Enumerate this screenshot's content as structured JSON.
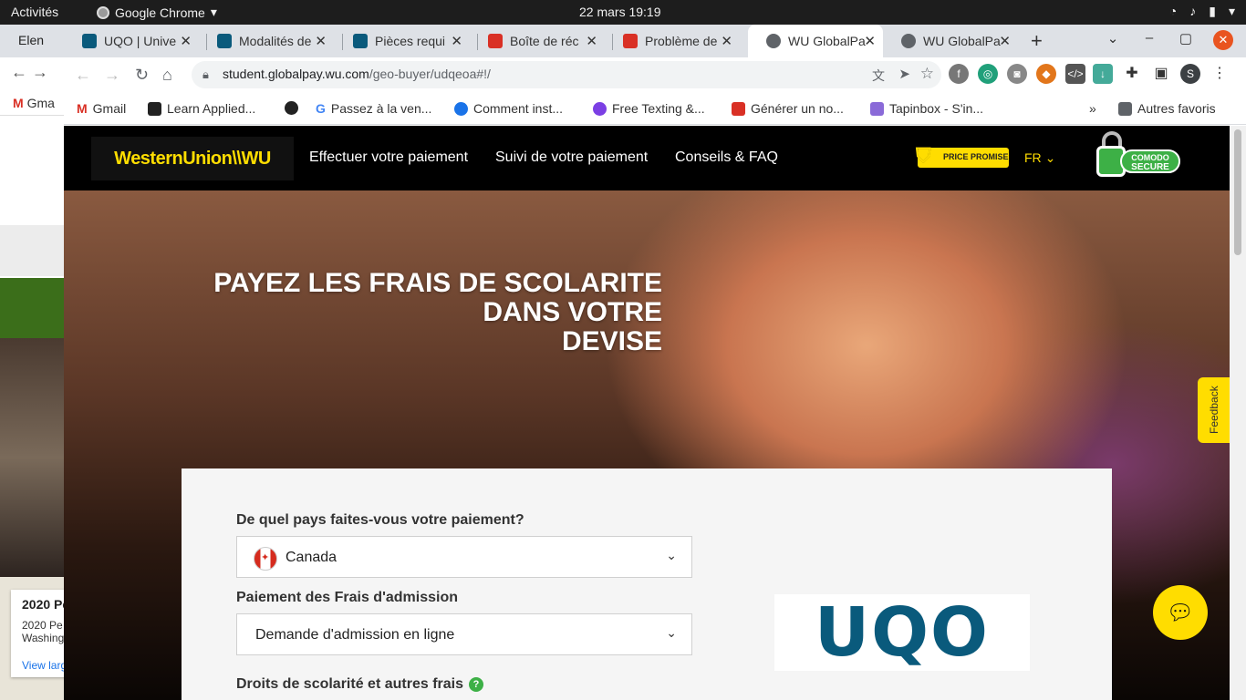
{
  "topbar": {
    "activities": "Activités",
    "app_name": "Google Chrome",
    "clock": "22 mars  19:19"
  },
  "bg_window": {
    "tab_label": "Elen",
    "bookmark": "Gma",
    "map_card_title": "2020 Pe",
    "map_card_line1": "2020 Pe",
    "map_card_line2": "Washing",
    "map_card_link": "View larg"
  },
  "tabs": [
    {
      "label": "UQO | Unive",
      "color": "#0a5a7c"
    },
    {
      "label": "Modalités de",
      "color": "#0a5a7c"
    },
    {
      "label": "Pièces requi",
      "color": "#0a5a7c"
    },
    {
      "label": "Boîte de réc",
      "color": "#d93025"
    },
    {
      "label": "Problème de",
      "color": "#d93025"
    },
    {
      "label": "WU GlobalPa",
      "color": "#5f6368"
    },
    {
      "label": "WU GlobalPa",
      "color": "#5f6368"
    }
  ],
  "omnibox": {
    "host": "student.globalpay.wu.com",
    "path": "/geo-buyer/udqeoa#!/"
  },
  "profile_initial": "S",
  "bookmarks": [
    {
      "label": "Gmail",
      "color": "#d93025"
    },
    {
      "label": "Learn Applied...",
      "color": "#222222"
    },
    {
      "label": "",
      "color": "#222222"
    },
    {
      "label": "Passez à la ven...",
      "color": "#4285f4"
    },
    {
      "label": "Comment inst...",
      "color": "#1a73e8"
    },
    {
      "label": "Free Texting &...",
      "color": "#7b3fe4"
    },
    {
      "label": "Générer un no...",
      "color": "#d93025"
    },
    {
      "label": "Tapinbox - S'in...",
      "color": "#8a6ad8"
    }
  ],
  "bookmarks_overflow": "»",
  "bookmarks_other": "Autres favoris",
  "wu": {
    "logo": "WesternUnion\\\\WU",
    "nav": [
      "Effectuer votre paiement",
      "Suivi de votre paiement",
      "Conseils & FAQ"
    ],
    "price_promise": "PRICE PROMISE",
    "lang": "FR",
    "comodo_line1": "COMODO",
    "comodo_line2": "SECURE",
    "accent": "#ffdd00"
  },
  "hero": {
    "title_line1": "PAYEZ LES FRAIS DE SCOLARITE",
    "title_line2": "DANS VOTRE",
    "title_line3": "DEVISE",
    "feedback": "Feedback"
  },
  "form": {
    "country_label": "De quel pays faites-vous votre paiement?",
    "country_value": "Canada",
    "payment_label": "Paiement des Frais d'admission",
    "payment_value": "Demande d'admission en ligne",
    "fees_label": "Droits de scolarité et autres frais",
    "school_logo": "UQO"
  }
}
